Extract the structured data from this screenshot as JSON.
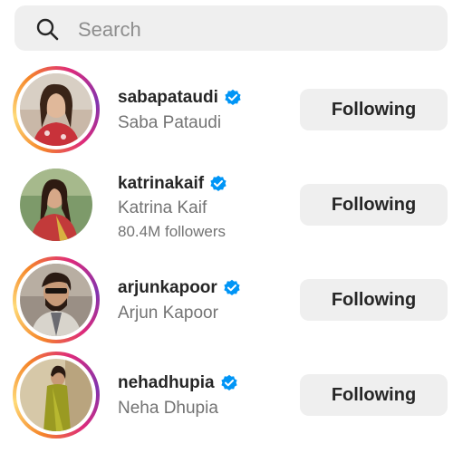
{
  "search": {
    "placeholder": "Search",
    "icon": "search-icon"
  },
  "accounts": [
    {
      "username": "sabapataudi",
      "full_name": "Saba Pataudi",
      "extra": "",
      "button": "Following",
      "story_ring": true
    },
    {
      "username": "katrinakaif",
      "full_name": "Katrina Kaif",
      "extra": "80.4M followers",
      "button": "Following",
      "story_ring": false
    },
    {
      "username": "arjunkapoor",
      "full_name": "Arjun Kapoor",
      "extra": "",
      "button": "Following",
      "story_ring": true
    },
    {
      "username": "nehadhupia",
      "full_name": "Neha Dhupia",
      "extra": "",
      "button": "Following",
      "story_ring": true
    }
  ],
  "colors": {
    "verified": "#0095f6",
    "button_bg": "#efefef",
    "secondary_text": "#737373"
  }
}
